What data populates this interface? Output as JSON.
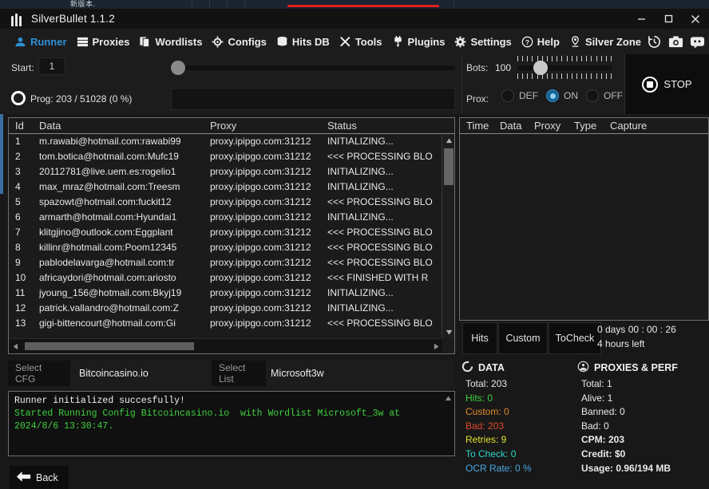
{
  "window": {
    "title": "SilverBullet 1.1.2",
    "behind_window_title": "新版本.",
    "minimize": "—",
    "maximize": "□",
    "close": "✕"
  },
  "nav": {
    "items": [
      {
        "label": "Runner",
        "icon": "runner-icon",
        "active": true
      },
      {
        "label": "Proxies",
        "icon": "proxies-icon",
        "active": false
      },
      {
        "label": "Wordlists",
        "icon": "wordlists-icon",
        "active": false
      },
      {
        "label": "Configs",
        "icon": "configs-icon",
        "active": false
      },
      {
        "label": "Hits DB",
        "icon": "hits-db-icon",
        "active": false
      },
      {
        "label": "Tools",
        "icon": "tools-icon",
        "active": false
      },
      {
        "label": "Plugins",
        "icon": "plugins-icon",
        "active": false
      },
      {
        "label": "Settings",
        "icon": "settings-icon",
        "active": false
      },
      {
        "label": "Help",
        "icon": "help-icon",
        "active": false
      },
      {
        "label": "Silver Zone",
        "icon": "location-icon",
        "active": false
      }
    ],
    "right_icons": [
      "history-icon",
      "camera-icon",
      "discord-icon",
      "telegram-icon"
    ]
  },
  "controls": {
    "start_label": "Start:",
    "start_value": "1",
    "progress_label": "Prog:",
    "progress_text": "Prog: 203 / 51028  (0 %)",
    "progress_current": 203,
    "progress_total": 51028,
    "progress_percent": 0,
    "bots_label": "Bots:",
    "bots_value": "100",
    "prox_label": "Prox:",
    "prox_options": [
      "DEF",
      "ON",
      "OFF"
    ],
    "prox_selected": "ON",
    "stop_label": "STOP"
  },
  "main_table": {
    "columns": [
      "Id",
      "Data",
      "Proxy",
      "Status"
    ],
    "rows": [
      {
        "id": "1",
        "data": "m.rawabi@hotmail.com:rawabi99",
        "proxy": "proxy.ipipgo.com:31212",
        "status": "INITIALIZING..."
      },
      {
        "id": "2",
        "data": "tom.botica@hotmail.com:Mufc19",
        "proxy": "proxy.ipipgo.com:31212",
        "status": "<<< PROCESSING BLO"
      },
      {
        "id": "3",
        "data": "20112781@live.uem.es:rogelio1",
        "proxy": "proxy.ipipgo.com:31212",
        "status": "INITIALIZING..."
      },
      {
        "id": "4",
        "data": "max_mraz@hotmail.com:Treesm",
        "proxy": "proxy.ipipgo.com:31212",
        "status": "INITIALIZING..."
      },
      {
        "id": "5",
        "data": "spazowt@hotmail.com:fuckit12",
        "proxy": "proxy.ipipgo.com:31212",
        "status": "<<< PROCESSING BLO"
      },
      {
        "id": "6",
        "data": "armarth@hotmail.com:Hyundai1",
        "proxy": "proxy.ipipgo.com:31212",
        "status": "INITIALIZING..."
      },
      {
        "id": "7",
        "data": "klitgjino@outlook.com:Eggplant",
        "proxy": "proxy.ipipgo.com:31212",
        "status": "<<< PROCESSING BLO"
      },
      {
        "id": "8",
        "data": "killinr@hotmail.com:Poom12345",
        "proxy": "proxy.ipipgo.com:31212",
        "status": "<<< PROCESSING BLO"
      },
      {
        "id": "9",
        "data": "pablodelavarga@hotmail.com:tr",
        "proxy": "proxy.ipipgo.com:31212",
        "status": "<<< PROCESSING BLO"
      },
      {
        "id": "10",
        "data": "africaydori@hotmail.com:ariosto",
        "proxy": "proxy.ipipgo.com:31212",
        "status": "<<< FINISHED WITH R"
      },
      {
        "id": "11",
        "data": "jyoung_156@hotmail.com:Bkyj19",
        "proxy": "proxy.ipipgo.com:31212",
        "status": "INITIALIZING..."
      },
      {
        "id": "12",
        "data": "patrick.vallandro@hotmail.com:Z",
        "proxy": "proxy.ipipgo.com:31212",
        "status": "INITIALIZING..."
      },
      {
        "id": "13",
        "data": "gigi-bittencourt@hotmail.com:Gi",
        "proxy": "proxy.ipipgo.com:31212",
        "status": "<<< PROCESSING BLO"
      }
    ]
  },
  "hits_panel": {
    "columns": [
      "Time",
      "Data",
      "Proxy",
      "Type",
      "Capture"
    ],
    "rows": [],
    "tabs": [
      "Hits",
      "Custom",
      "ToCheck"
    ],
    "timer_line1": "0  days  00 : 00 : 26",
    "timer_line2": "4 hours left"
  },
  "stats": {
    "data": {
      "title": "DATA",
      "icon": "data-circle-icon",
      "lines": [
        {
          "label": "Total:",
          "value": "203",
          "color": "#e8e8e8"
        },
        {
          "label": "Hits:",
          "value": "0",
          "color": "#3dd13d"
        },
        {
          "label": "Custom:",
          "value": "0",
          "color": "#e08b2a"
        },
        {
          "label": "Bad:",
          "value": "203",
          "color": "#e04a2a"
        },
        {
          "label": "Retries:",
          "value": "9",
          "color": "#e0e02a"
        },
        {
          "label": "To Check:",
          "value": "0",
          "color": "#2ad6c8"
        },
        {
          "label": "OCR Rate:",
          "value": "0 %",
          "color": "#4aa6e0"
        }
      ]
    },
    "proxies": {
      "title": "PROXIES & PERF",
      "icon": "proxies-perf-icon",
      "lines": [
        {
          "label": "Total:",
          "value": "1",
          "bold": false
        },
        {
          "label": "Alive:",
          "value": "1",
          "bold": false
        },
        {
          "label": "Banned:",
          "value": "0",
          "bold": false
        },
        {
          "label": "Bad:",
          "value": "0",
          "bold": false
        },
        {
          "label": "CPM:",
          "value": "203",
          "bold": true
        },
        {
          "label": "Credit:",
          "value": "$0",
          "bold": true
        },
        {
          "label": "Usage:",
          "value": "0.96/194 MB",
          "bold": true
        }
      ]
    }
  },
  "selectors": {
    "cfg_button": "Select CFG",
    "cfg_value": "Bitcoincasino.io",
    "list_button": "Select List",
    "list_value": "Microsoft3w"
  },
  "log": {
    "lines": [
      {
        "text": "Runner initialized succesfully!",
        "color": "#f0f0f0"
      },
      {
        "text": "Started Running Config Bitcoincasino.io  with Wordlist Microsoft_3w at",
        "color": "#3fd03f"
      },
      {
        "text": "2024/8/6 13:30:47.",
        "color": "#3fd03f"
      }
    ]
  },
  "footer": {
    "back_label": "Back",
    "back_icon": "arrow-left-icon"
  }
}
